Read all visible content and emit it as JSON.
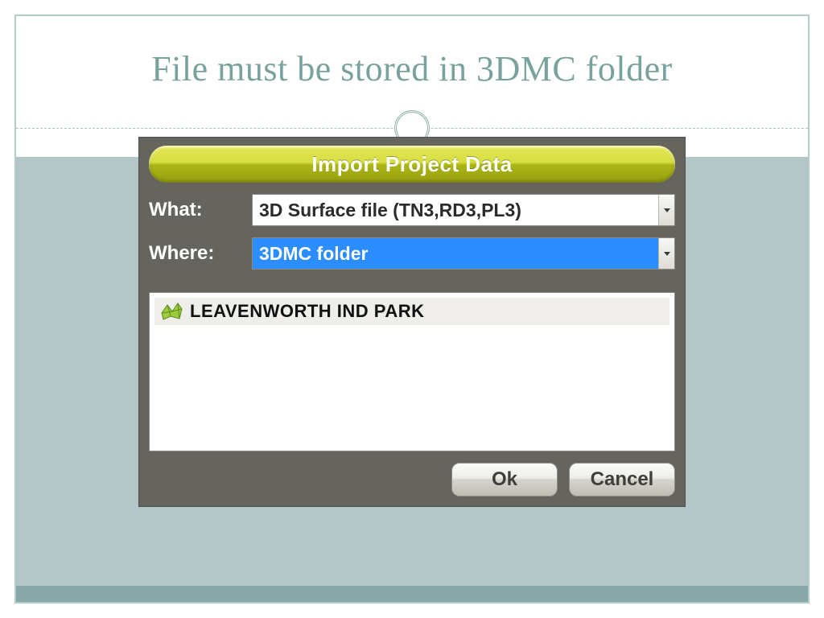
{
  "slide": {
    "title": "File must be stored in 3DMC folder"
  },
  "dialog": {
    "title": "Import Project Data",
    "labels": {
      "what": "What:",
      "where": "Where:"
    },
    "what_value": "3D Surface file (TN3,RD3,PL3)",
    "where_value": "3DMC folder",
    "list": {
      "items": [
        "LEAVENWORTH IND PARK"
      ]
    },
    "buttons": {
      "ok": "Ok",
      "cancel": "Cancel"
    }
  }
}
